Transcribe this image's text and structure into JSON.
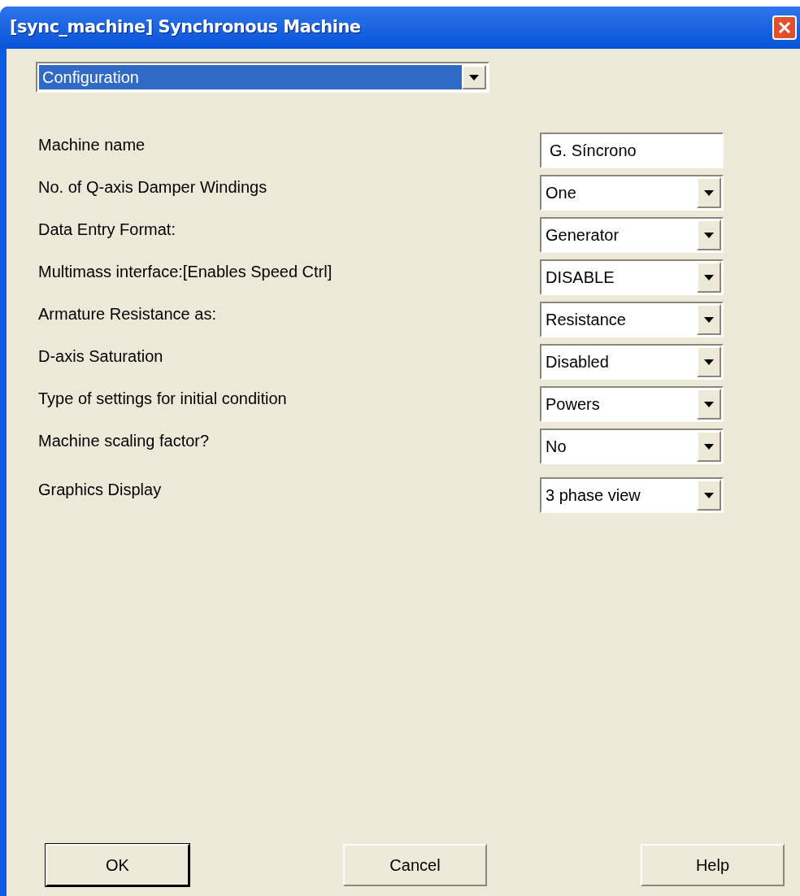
{
  "window": {
    "title": "[sync_machine] Synchronous Machine"
  },
  "section_select": {
    "value": "Configuration",
    "focused": true
  },
  "fields": [
    {
      "label": "Machine name",
      "kind": "text",
      "value": "G. Síncrono"
    },
    {
      "label": "No. of Q-axis Damper Windings",
      "kind": "dropdown",
      "value": "One"
    },
    {
      "label": "Data Entry Format:",
      "kind": "dropdown",
      "value": "Generator"
    },
    {
      "label": "Multimass interface:[Enables Speed Ctrl]",
      "kind": "dropdown",
      "value": "DISABLE"
    },
    {
      "label": "Armature Resistance as:",
      "kind": "dropdown",
      "value": "Resistance"
    },
    {
      "label": "D-axis Saturation",
      "kind": "dropdown",
      "value": "Disabled"
    },
    {
      "label": "Type of settings for initial condition",
      "kind": "dropdown",
      "value": "Powers"
    },
    {
      "label": "Machine scaling factor?",
      "kind": "dropdown",
      "value": "No"
    },
    {
      "label": "Graphics Display",
      "kind": "dropdown",
      "value": "3 phase view"
    }
  ],
  "buttons": [
    {
      "label": "OK",
      "default": true
    },
    {
      "label": "Cancel",
      "default": false
    },
    {
      "label": "Help",
      "default": false
    }
  ]
}
